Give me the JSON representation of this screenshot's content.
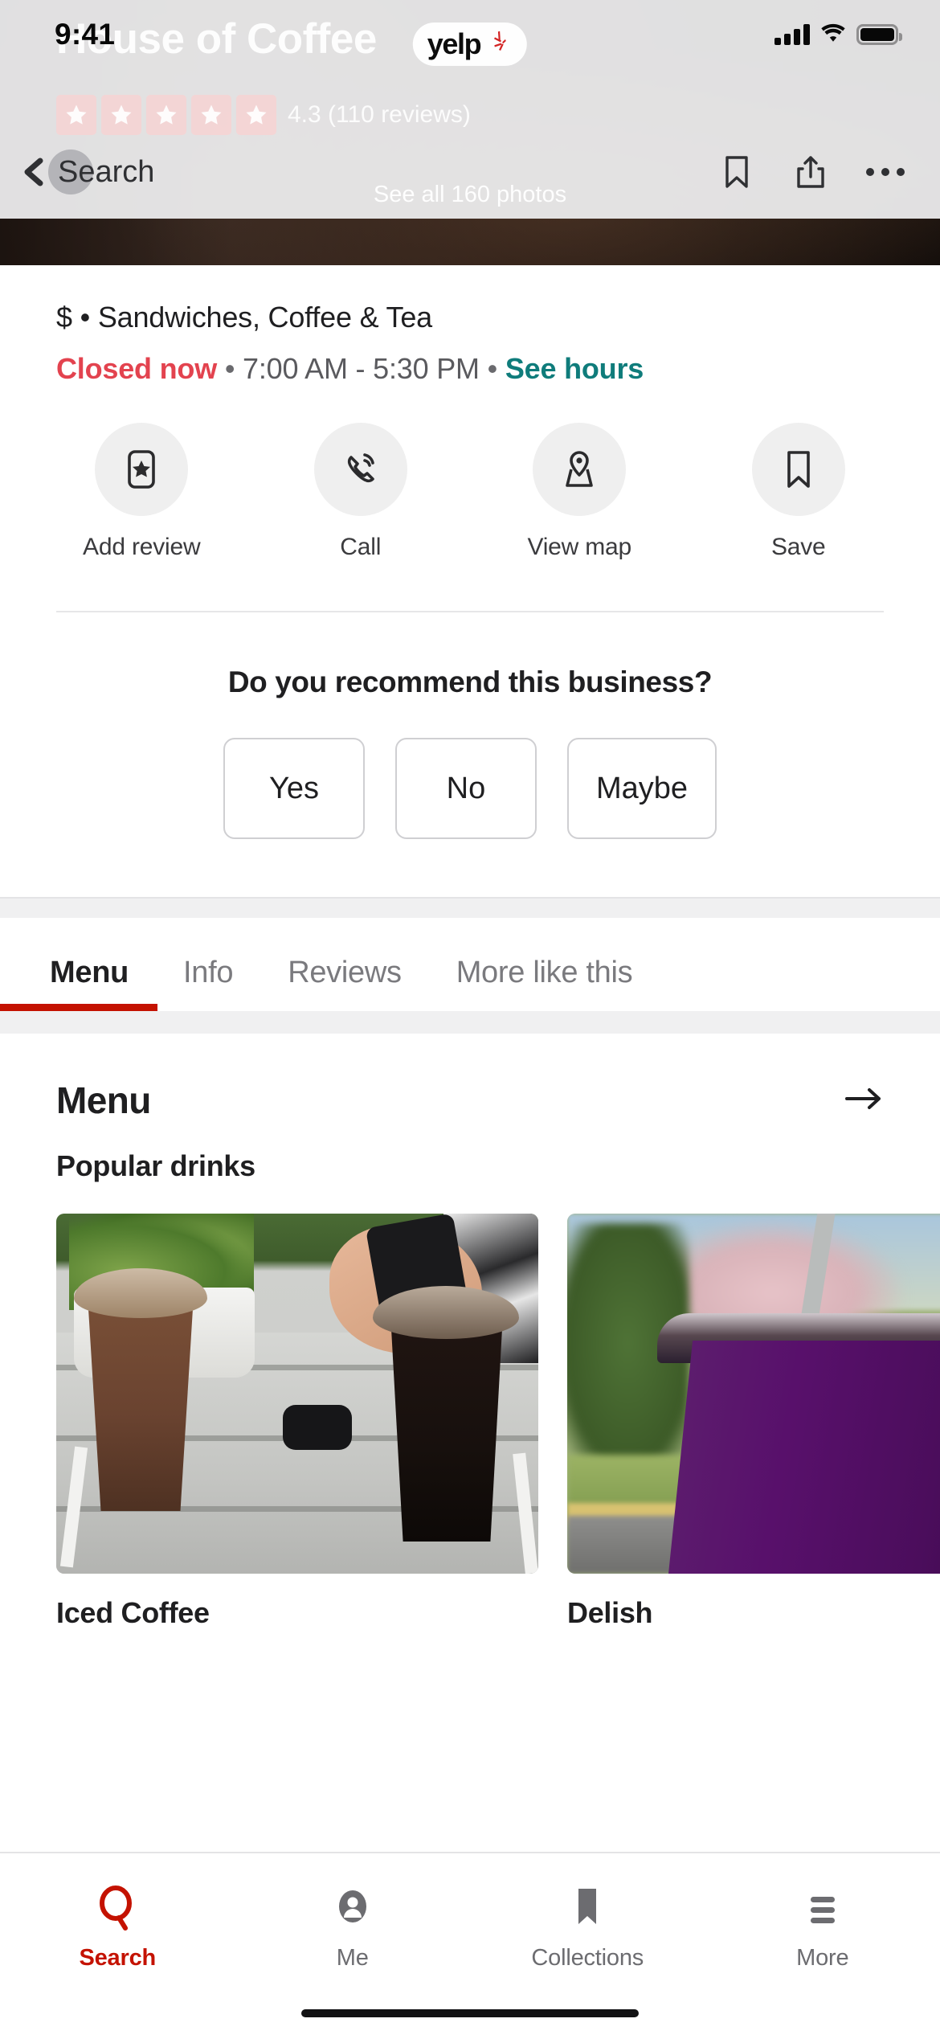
{
  "status_bar": {
    "time": "9:41",
    "signal_icon": "cellular-signal-icon",
    "wifi_icon": "wifi-icon",
    "battery_icon": "battery-icon"
  },
  "brand": {
    "name": "yelp",
    "logo_icon": "yelp-burst-icon",
    "accent_red": "#c41200",
    "burst_red": "#d32323"
  },
  "hero": {
    "business_name": "House of Coffee",
    "rating_value": "4.3",
    "rating_text": "4.3 (110 reviews)",
    "review_count": "110",
    "stars_filled": 5,
    "see_all_photos": "See all 160 photos",
    "photo_count": "160"
  },
  "navbar": {
    "back_label": "Search",
    "back_icon": "chevron-left-icon",
    "save_icon": "bookmark-icon",
    "share_icon": "share-icon",
    "more_icon": "ellipsis-icon"
  },
  "business": {
    "price_and_categories": "$ • Sandwiches, Coffee & Tea",
    "status": "Closed now",
    "status_color": "#e3434f",
    "hours": "7:00 AM - 5:30 PM",
    "see_hours_label": "See hours",
    "see_hours_color": "#0f7c7b",
    "dot_1": "•",
    "dot_2": "•"
  },
  "actions": [
    {
      "label": "Add review",
      "icon": "add-review-star-icon"
    },
    {
      "label": "Call",
      "icon": "phone-icon"
    },
    {
      "label": "View map",
      "icon": "map-pin-icon"
    },
    {
      "label": "Save",
      "icon": "bookmark-icon"
    }
  ],
  "recommend": {
    "question": "Do you recommend this business?",
    "options": [
      "Yes",
      "No",
      "Maybe"
    ]
  },
  "tabs": {
    "items": [
      "Menu",
      "Info",
      "Reviews",
      "More like this"
    ],
    "active_index": 0,
    "active_underline_color": "#c41200"
  },
  "menu_section": {
    "title": "Menu",
    "arrow_icon": "arrow-right-icon",
    "subtitle": "Popular drinks",
    "cards": [
      {
        "caption": "Iced Coffee",
        "photo_alt": "two iced coffee cups on a patio table"
      },
      {
        "caption": "Delish",
        "photo_alt": "purple iced drink outdoors"
      }
    ]
  },
  "bottom_nav": {
    "items": [
      {
        "label": "Search",
        "icon": "search-icon",
        "active": true
      },
      {
        "label": "Me",
        "icon": "person-icon",
        "active": false
      },
      {
        "label": "Collections",
        "icon": "bookmark-filled-icon",
        "active": false
      },
      {
        "label": "More",
        "icon": "hamburger-menu-icon",
        "active": false
      }
    ]
  }
}
